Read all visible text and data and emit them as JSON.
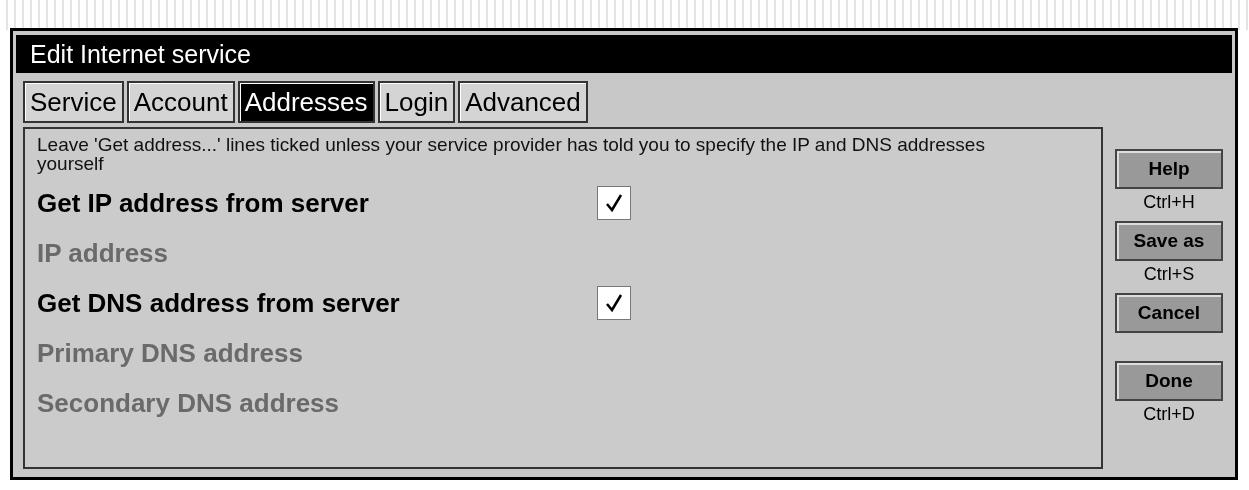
{
  "window": {
    "title": "Edit Internet service"
  },
  "tabs": [
    {
      "label": "Service",
      "selected": false
    },
    {
      "label": "Account",
      "selected": false
    },
    {
      "label": "Addresses",
      "selected": true
    },
    {
      "label": "Login",
      "selected": false
    },
    {
      "label": "Advanced",
      "selected": false
    }
  ],
  "description": "Leave 'Get address...' lines ticked unless your service provider has told you to specify the IP and DNS addresses yourself",
  "rows": [
    {
      "kind": "checkbox",
      "label": "Get IP address from server",
      "checked": true
    },
    {
      "kind": "field",
      "label": "IP address",
      "disabled": true
    },
    {
      "kind": "checkbox",
      "label": "Get DNS address from server",
      "checked": true
    },
    {
      "kind": "field",
      "label": "Primary DNS address",
      "disabled": true
    },
    {
      "kind": "field",
      "label": "Secondary DNS address",
      "disabled": true
    }
  ],
  "buttons": [
    {
      "label": "Help",
      "shortcut": "Ctrl+H"
    },
    {
      "label": "Save as",
      "shortcut": "Ctrl+S"
    },
    {
      "label": "Cancel"
    },
    {
      "label": "Done",
      "shortcut": "Ctrl+D"
    }
  ]
}
